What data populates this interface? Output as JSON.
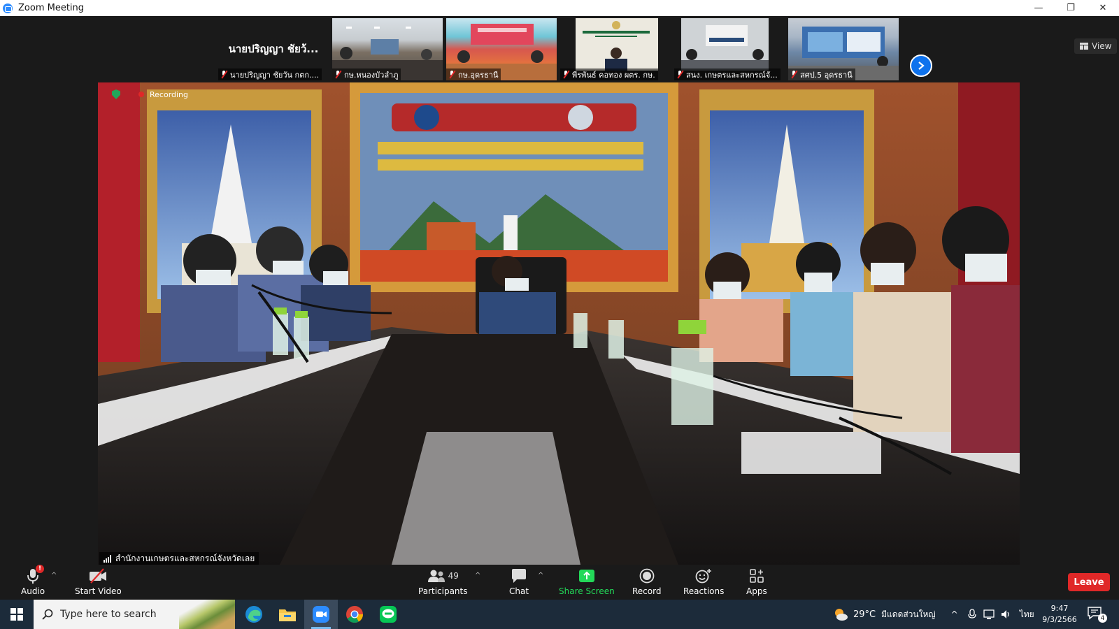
{
  "window": {
    "title": "Zoom Meeting",
    "minimize_glyph": "—",
    "maximize_glyph": "❐",
    "close_glyph": "✕"
  },
  "top_strip": {
    "text_tile": {
      "big_name": "นายปริญญา ชัยว้...",
      "label": "นายปริญญา ชัยวัน กตก...."
    },
    "thumbnails": [
      {
        "label": "กษ.หนองบัวลำภู",
        "muted": true,
        "icon": "meeting-room-photo"
      },
      {
        "label": "กษ.อุดรธานี",
        "muted": true,
        "icon": "meeting-room-photo"
      },
      {
        "label": "พีรพันธ์ คอทอง ผตร. กษ.",
        "muted": true,
        "icon": "person-photo"
      },
      {
        "label": "สนง. เกษตรและสหกรณ์จั...",
        "muted": true,
        "icon": "meeting-room-photo"
      },
      {
        "label": "สศป.5 อุดรธานี",
        "muted": true,
        "icon": "meeting-room-photo"
      }
    ],
    "view_label": "View"
  },
  "main_video": {
    "recording_label": "Recording",
    "speaker_label": "สำนักงานเกษตรและสหกรณ์จังหวัดเลย"
  },
  "toolbar": {
    "audio": {
      "label": "Audio",
      "alert": "!"
    },
    "video": {
      "label": "Start Video"
    },
    "participants": {
      "label": "Participants",
      "count": "49"
    },
    "chat": {
      "label": "Chat"
    },
    "share": {
      "label": "Share Screen"
    },
    "record": {
      "label": "Record"
    },
    "reactions": {
      "label": "Reactions"
    },
    "apps": {
      "label": "Apps"
    },
    "leave": {
      "label": "Leave"
    },
    "colors": {
      "share_green": "#23d959",
      "leave_red": "#e02828"
    }
  },
  "taskbar": {
    "search_placeholder": "Type here to search",
    "apps": [
      "edge-icon",
      "file-explorer-icon",
      "zoom-icon",
      "chrome-icon",
      "line-icon"
    ],
    "weather": {
      "temp": "29°C",
      "desc": "มีแดดส่วนใหญ่"
    },
    "language": "ไทย",
    "time": "9:47",
    "date": "9/3/2566",
    "notifications": "4"
  }
}
